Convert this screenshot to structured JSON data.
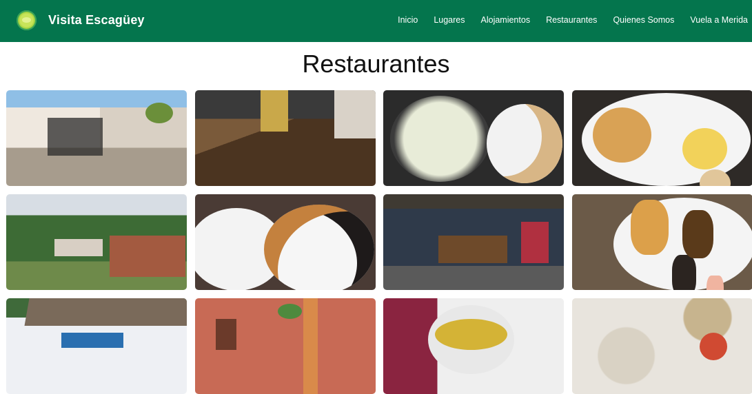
{
  "header": {
    "brand": "Visita Escagüey",
    "background_color": "#04754d",
    "nav": [
      "Inicio",
      "Lugares",
      "Alojamientos",
      "Restaurantes",
      "Quienes Somos",
      "Vuela a Merida"
    ]
  },
  "page": {
    "title": "Restaurantes"
  },
  "gallery": {
    "images": [
      "restaurant-exterior-cafe",
      "restaurant-interior-wooden-tables",
      "soup-with-arepas",
      "breakfast-plate-eggs-avocado",
      "mountain-village-houses",
      "two-plates-pabellon-dishes",
      "rustic-dining-room-interior",
      "breakfast-plate-arepas-beans",
      "el-baquiano-restaurant-sign",
      "colonial-red-corridor",
      "yellow-soup-bowl",
      "dish-with-tomato-garnish"
    ]
  }
}
